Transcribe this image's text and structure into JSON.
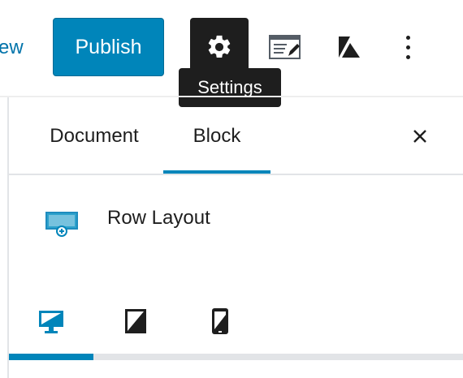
{
  "toolbar": {
    "preview_label": "ew",
    "publish_label": "Publish",
    "settings_tooltip": "Settings",
    "icons": {
      "settings": "gear-icon",
      "editor_mode": "code-editor-icon",
      "kadence": "kadence-logo-icon",
      "more": "more-vertical-icon"
    }
  },
  "sidebar": {
    "tabs": [
      {
        "label": "Document",
        "active": false
      },
      {
        "label": "Block",
        "active": true
      }
    ],
    "close_icon": "close-icon",
    "block": {
      "icon": "row-layout-icon",
      "title": "Row Layout"
    },
    "device_tabs": [
      {
        "name": "desktop",
        "icon": "desktop-icon",
        "active": true
      },
      {
        "name": "tablet",
        "icon": "tablet-icon",
        "active": false
      },
      {
        "name": "mobile",
        "icon": "mobile-icon",
        "active": false
      }
    ]
  },
  "colors": {
    "accent": "#0085ba",
    "link": "#0073aa",
    "dark": "#1e1e1e",
    "divider": "#e2e4e7"
  }
}
